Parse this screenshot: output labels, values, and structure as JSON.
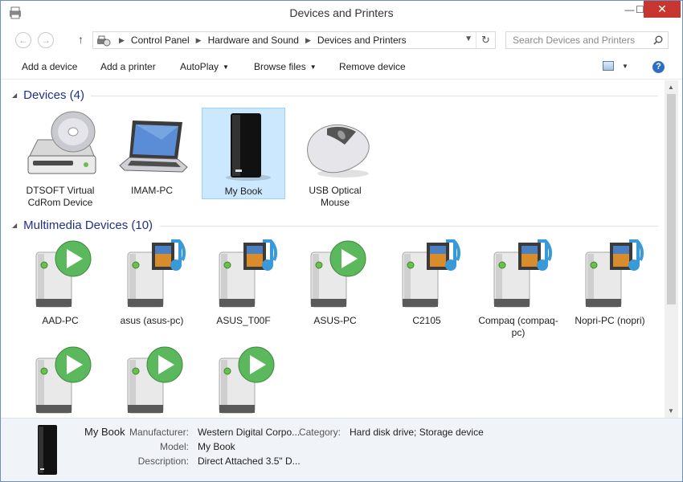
{
  "window": {
    "title": "Devices and Printers",
    "minimize": "—",
    "maximize": "☐",
    "close": "✕"
  },
  "nav": {
    "back": "←",
    "forward": "→",
    "up": "↑",
    "breadcrumb": [
      "Control Panel",
      "Hardware and Sound",
      "Devices and Printers"
    ],
    "refresh": "↻",
    "search_placeholder": "Search Devices and Printers"
  },
  "toolbar": {
    "add_device": "Add a device",
    "add_printer": "Add a printer",
    "autoplay": "AutoPlay",
    "browse_files": "Browse files",
    "remove_device": "Remove device",
    "help": "?"
  },
  "groups": {
    "devices": {
      "title": "Devices (4)",
      "items": [
        {
          "label": "DTSOFT Virtual CdRom Device",
          "icon": "cdrom-drive-icon"
        },
        {
          "label": "IMAM-PC",
          "icon": "laptop-icon"
        },
        {
          "label": "My Book",
          "icon": "external-hard-drive-icon",
          "selected": true
        },
        {
          "label": "USB Optical Mouse",
          "icon": "mouse-icon"
        }
      ]
    },
    "multimedia": {
      "title": "Multimedia Devices (10)",
      "items": [
        {
          "label": "AAD-PC",
          "icon": "media-server-play-icon"
        },
        {
          "label": "asus (asus-pc)",
          "icon": "media-server-music-icon"
        },
        {
          "label": "ASUS_T00F",
          "icon": "media-server-music-icon"
        },
        {
          "label": "ASUS-PC",
          "icon": "media-server-play-icon"
        },
        {
          "label": "C2105",
          "icon": "media-server-music-icon"
        },
        {
          "label": "Compaq (compaq-pc)",
          "icon": "media-server-music-icon"
        },
        {
          "label": "Nopri-PC (nopri)",
          "icon": "media-server-music-icon"
        },
        {
          "label": "",
          "icon": "media-server-play-icon"
        },
        {
          "label": "",
          "icon": "media-server-play-icon"
        },
        {
          "label": "",
          "icon": "media-server-play-icon"
        }
      ]
    }
  },
  "details": {
    "name": "My Book",
    "manufacturer_label": "Manufacturer:",
    "manufacturer": "Western Digital Corpo...",
    "model_label": "Model:",
    "model": "My Book",
    "description_label": "Description:",
    "description": "Direct Attached 3.5\" D...",
    "category_label": "Category:",
    "category": "Hard disk drive; Storage device"
  },
  "colors": {
    "accent": "#1e3287",
    "selection": "#cce8ff",
    "close_button": "#c7372f",
    "play_green": "#5cb85c",
    "music_blue": "#3a9ad9"
  }
}
